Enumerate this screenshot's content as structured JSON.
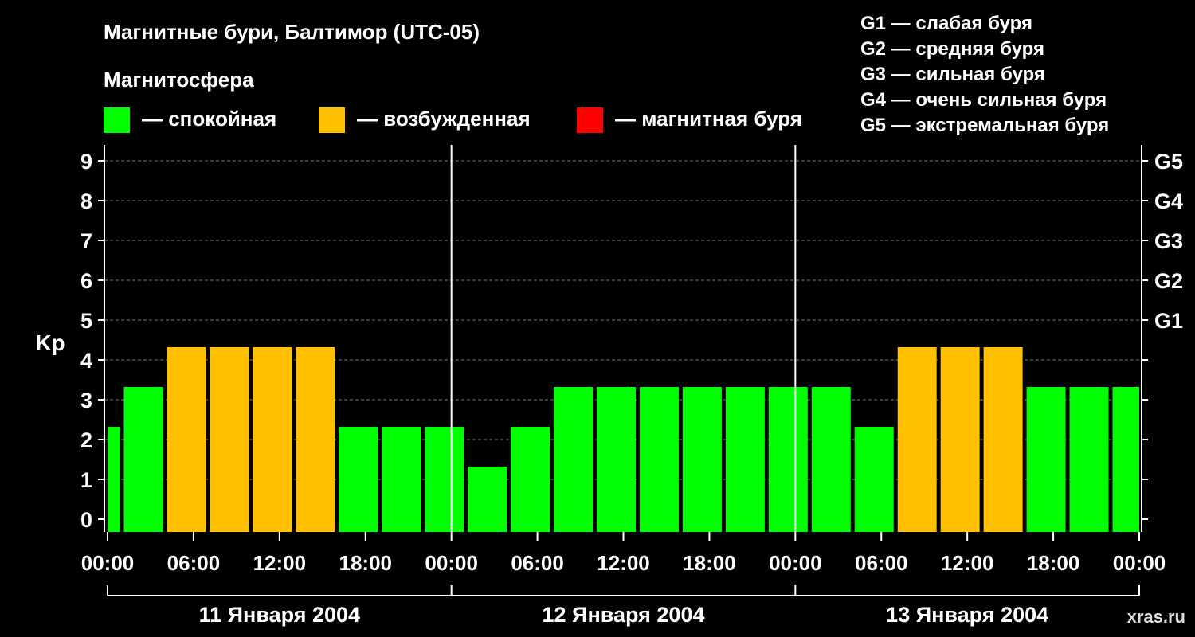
{
  "title": "Магнитные бури, Балтимор (UTC-05)",
  "legend": {
    "heading": "Магнитосфера",
    "items": [
      {
        "label": "— спокойная",
        "color": "#00ff00"
      },
      {
        "label": "— возбужденная",
        "color": "#ffc000"
      },
      {
        "label": "— магнитная буря",
        "color": "#ff0000"
      }
    ]
  },
  "g_legend": [
    "G1 — слабая буря",
    "G2 — средняя буря",
    "G3 — сильная буря",
    "G4 — очень сильная буря",
    "G5 — экстремальная буря"
  ],
  "watermark": "xras.ru",
  "chart_data": {
    "type": "bar",
    "ylabel": "Kp",
    "ylim": [
      0,
      9
    ],
    "yticks": [
      "0",
      "1",
      "2",
      "3",
      "4",
      "5",
      "6",
      "7",
      "8",
      "9"
    ],
    "right_ticks": [
      {
        "kp": 5,
        "label": "G1"
      },
      {
        "kp": 6,
        "label": "G2"
      },
      {
        "kp": 7,
        "label": "G3"
      },
      {
        "kp": 8,
        "label": "G4"
      },
      {
        "kp": 9,
        "label": "G5"
      }
    ],
    "xticks": [
      "00:00",
      "06:00",
      "12:00",
      "18:00",
      "00:00",
      "06:00",
      "12:00",
      "18:00",
      "00:00",
      "06:00",
      "12:00",
      "18:00",
      "00:00"
    ],
    "days": [
      "11 Января 2004",
      "12 Января 2004",
      "13 Января 2004"
    ],
    "x_start_hour": 0,
    "x_end_hour": 72,
    "bar_period_hours": 3,
    "first_bar_start_hour": -2,
    "values": [
      2,
      3,
      4,
      4,
      4,
      4,
      2,
      2,
      2,
      1,
      2,
      3,
      3,
      3,
      3,
      3,
      3,
      3,
      2,
      4,
      4,
      4,
      3,
      3,
      3
    ],
    "colors": {
      "quiet": "#00ff00",
      "active": "#ffc000",
      "storm": "#ff0000"
    },
    "grid": true
  }
}
